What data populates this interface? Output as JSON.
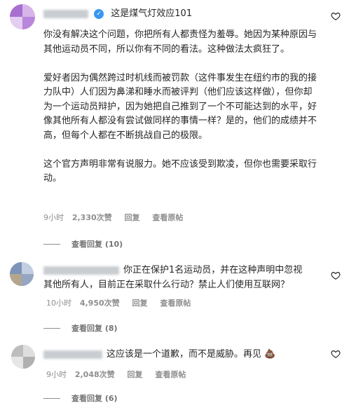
{
  "comments": [
    {
      "verified_label": "✓",
      "handle_suffix": "这是煤气灯效应101",
      "paragraphs": [
        "你没有解决这个问题，你把所有人都责怪为羞辱。她因为某种原因与其他运动员不同，所以你有不同的看法。这种做法太疯狂了。",
        "爱好者因为偶然跨过时机线而被罚款（这件事发生在纽约市的我的接力队中）人们因为鼻涕和睡水而被评判（他们应该这样做），但你却为一个运动员辩护，因为她把自己推到了一个不可能达到的水平，好像其他所有人都没有尝试做同样的事情一样？是的，他们的成绩并不高，但每个人都在不断挑战自己的极限。",
        "这个官方声明非常有说服力。她不应该受到欺凌，但你也需要采取行动。"
      ],
      "time": "9小时",
      "likes": "2,330次赞",
      "reply": "回复",
      "view_original": "查看原帖",
      "view_replies": "查看回复 (10)"
    },
    {
      "line1": "你正在保护1名运动员，并在这种声明中忽视",
      "line2": "其他所有人，目前正在采取什么行动？禁止人们使用互联网？",
      "time": "10小时",
      "likes": "4,950次赞",
      "reply": "回复",
      "view_original": "查看原帖",
      "view_replies": "查看回复 (8)"
    },
    {
      "text": "这应该是一个道歉，而不是威胁。再见 💩",
      "time": "9小时",
      "likes": "2,048次赞",
      "reply": "回复",
      "view_original": "查看原帖",
      "view_replies": "查看回复 (6)"
    }
  ],
  "colors": {
    "text": "#262626",
    "meta": "#8e8e8e",
    "verified": "#3897f0",
    "avatar1": "#b98fd6",
    "avatar2": "#8fa3c4",
    "avatar3": "#c9c9c9"
  },
  "icons": {
    "heart": "heart-outline-icon",
    "verified": "verified-badge-icon"
  }
}
